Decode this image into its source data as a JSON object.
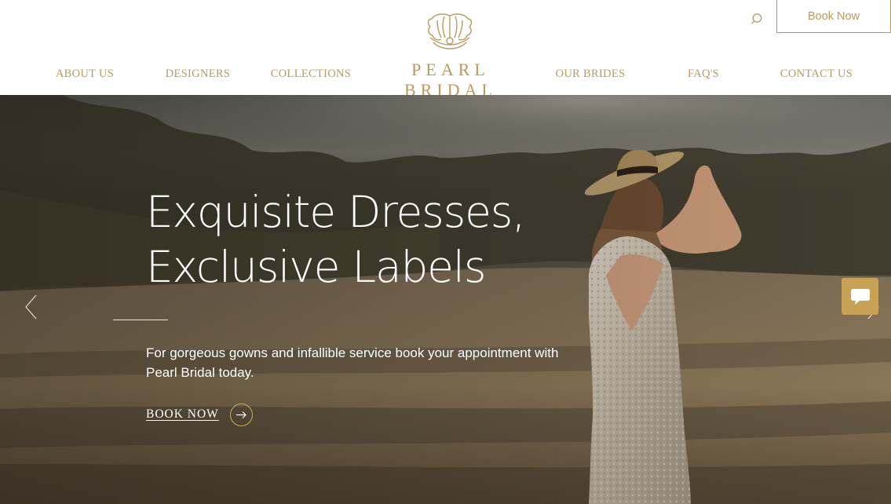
{
  "brand": {
    "name": "PEARL BRIDAL",
    "logo_icon": "shell-logo-icon",
    "accent_color": "#b89a5e"
  },
  "nav": {
    "items": [
      {
        "label": "ABOUT US"
      },
      {
        "label": "DESIGNERS"
      },
      {
        "label": "COLLECTIONS"
      },
      {
        "label": "OUR BRIDES"
      },
      {
        "label": "FAQ'S"
      },
      {
        "label": "CONTACT US"
      }
    ]
  },
  "header": {
    "search_icon": "search-icon",
    "book_button": "Book Now"
  },
  "hero": {
    "title_line1": "Exquisite Dresses,",
    "title_line2": "Exclusive Labels",
    "subtitle": "For gorgeous gowns and infallible service book your appointment with Pearl Bridal today.",
    "cta_label": "BOOK NOW",
    "cta_icon": "arrow-right-icon",
    "prev_icon": "chevron-left-icon",
    "next_icon": "chevron-right-icon"
  },
  "chat": {
    "icon": "chat-bubble-icon",
    "color": "#c9a153"
  }
}
